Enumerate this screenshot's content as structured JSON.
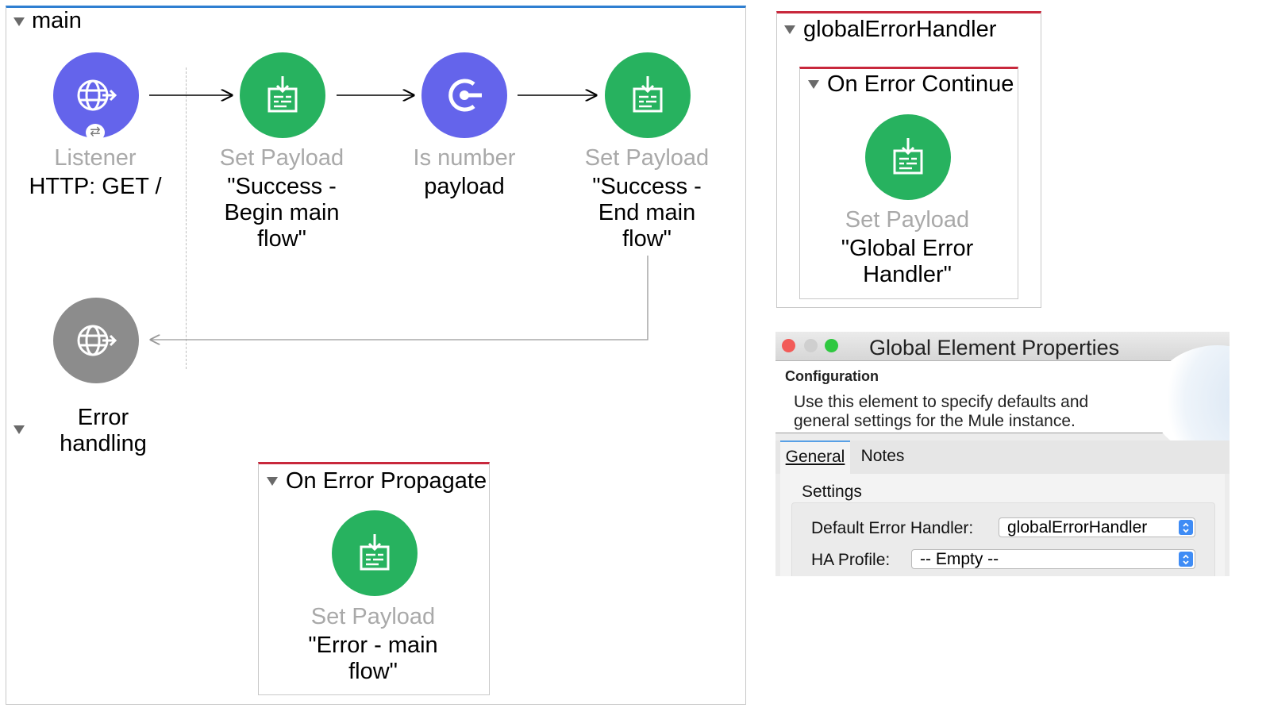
{
  "main_flow": {
    "title": "main",
    "nodes": [
      {
        "type": "Listener",
        "desc": "HTTP: GET /",
        "icon": "globe-icon"
      },
      {
        "type": "Set Payload",
        "desc": "\"Success - Begin main flow\"",
        "icon": "set-payload-icon"
      },
      {
        "type": "Is number",
        "desc": "payload",
        "icon": "validation-icon"
      },
      {
        "type": "Set Payload",
        "desc": "\"Success - End main flow\"",
        "icon": "set-payload-icon"
      }
    ],
    "error_handling": {
      "title": "Error handling",
      "scope": {
        "title": "On Error Propagate",
        "node": {
          "type": "Set Payload",
          "desc": "\"Error - main flow\"",
          "icon": "set-payload-icon"
        }
      }
    }
  },
  "global_handler": {
    "title": "globalErrorHandler",
    "scope": {
      "title": "On Error Continue",
      "node": {
        "type": "Set Payload",
        "desc": "\"Global Error Handler\"",
        "icon": "set-payload-icon"
      }
    }
  },
  "properties_window": {
    "title": "Global Element Properties",
    "section": "Configuration",
    "description": "Use this element to specify defaults and general settings for the Mule instance.",
    "tabs": [
      "General",
      "Notes"
    ],
    "active_tab": "General",
    "settings_label": "Settings",
    "fields": [
      {
        "label": "Default Error Handler:",
        "value": "globalErrorHandler"
      },
      {
        "label": "HA Profile:",
        "value": "-- Empty --"
      }
    ]
  },
  "colors": {
    "success_green": "#27b25f",
    "component_purple": "#6464eb",
    "source_gray": "#8c8c8c",
    "error_red": "#c8283c",
    "flow_blue": "#2f7fd1"
  }
}
